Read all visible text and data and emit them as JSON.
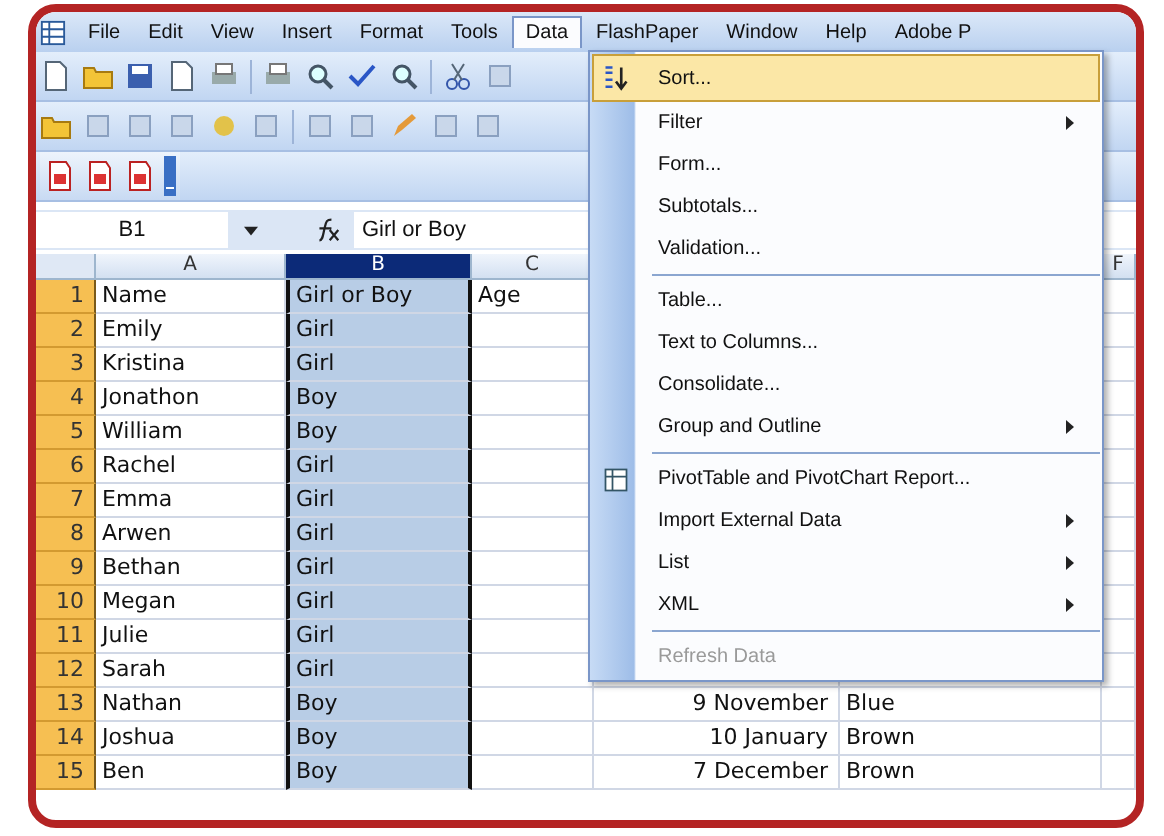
{
  "menu_bar": [
    {
      "label": "File",
      "selected": false
    },
    {
      "label": "Edit",
      "selected": false
    },
    {
      "label": "View",
      "selected": false
    },
    {
      "label": "Insert",
      "selected": false
    },
    {
      "label": "Format",
      "selected": false
    },
    {
      "label": "Tools",
      "selected": false
    },
    {
      "label": "Data",
      "selected": true
    },
    {
      "label": "FlashPaper",
      "selected": false
    },
    {
      "label": "Window",
      "selected": false
    },
    {
      "label": "Help",
      "selected": false
    },
    {
      "label": "Adobe P",
      "selected": false
    }
  ],
  "formula_bar": {
    "name_box": "B1",
    "value": "Girl or Boy"
  },
  "column_headers": [
    {
      "label": "A",
      "selected": false
    },
    {
      "label": "B",
      "selected": true
    },
    {
      "label": "C",
      "selected": false
    },
    {
      "label": "F",
      "selected": false
    }
  ],
  "rows": [
    {
      "number": "1",
      "name": "Name",
      "girl_or_boy": "Girl or Boy",
      "age": "Age"
    },
    {
      "number": "2",
      "name": "Emily",
      "girl_or_boy": "Girl"
    },
    {
      "number": "3",
      "name": "Kristina",
      "girl_or_boy": "Girl"
    },
    {
      "number": "4",
      "name": "Jonathon",
      "girl_or_boy": "Boy"
    },
    {
      "number": "5",
      "name": "William",
      "girl_or_boy": "Boy"
    },
    {
      "number": "6",
      "name": "Rachel",
      "girl_or_boy": "Girl"
    },
    {
      "number": "7",
      "name": "Emma",
      "girl_or_boy": "Girl"
    },
    {
      "number": "8",
      "name": "Arwen",
      "girl_or_boy": "Girl"
    },
    {
      "number": "9",
      "name": "Bethan",
      "girl_or_boy": "Girl"
    },
    {
      "number": "10",
      "name": "Megan",
      "girl_or_boy": "Girl"
    },
    {
      "number": "11",
      "name": "Julie",
      "girl_or_boy": "Girl"
    },
    {
      "number": "12",
      "name": "Sarah",
      "girl_or_boy": "Girl"
    },
    {
      "number": "13",
      "name": "Nathan",
      "girl_or_boy": "Boy",
      "column_d": "9 November",
      "column_e": "Blue"
    },
    {
      "number": "14",
      "name": "Joshua",
      "girl_or_boy": "Boy",
      "column_d": "10 January",
      "column_e": "Brown"
    },
    {
      "number": "15",
      "name": "Ben",
      "girl_or_boy": "Boy",
      "column_d": "7 December",
      "column_e": "Brown"
    }
  ],
  "data_menu": [
    {
      "kind": "command",
      "label": "Sort...",
      "selected": true
    },
    {
      "kind": "submenu",
      "label": "Filter",
      "selected": false
    },
    {
      "kind": "command",
      "label": "Form...",
      "selected": false
    },
    {
      "kind": "command",
      "label": "Subtotals...",
      "selected": false
    },
    {
      "kind": "command",
      "label": "Validation...",
      "selected": false
    },
    {
      "kind": "separator"
    },
    {
      "kind": "command",
      "label": "Table...",
      "selected": false
    },
    {
      "kind": "command",
      "label": "Text to Columns...",
      "selected": false
    },
    {
      "kind": "command",
      "label": "Consolidate...",
      "selected": false
    },
    {
      "kind": "submenu",
      "label": "Group and Outline",
      "selected": false
    },
    {
      "kind": "separator"
    },
    {
      "kind": "command",
      "label": "PivotTable and PivotChart Report...",
      "selected": false
    },
    {
      "kind": "submenu",
      "label": "Import External Data",
      "selected": false
    },
    {
      "kind": "submenu",
      "label": "List",
      "selected": false
    },
    {
      "kind": "submenu",
      "label": "XML",
      "selected": false
    },
    {
      "kind": "separator"
    },
    {
      "kind": "disabled",
      "label": "Refresh Data",
      "selected": false
    }
  ]
}
